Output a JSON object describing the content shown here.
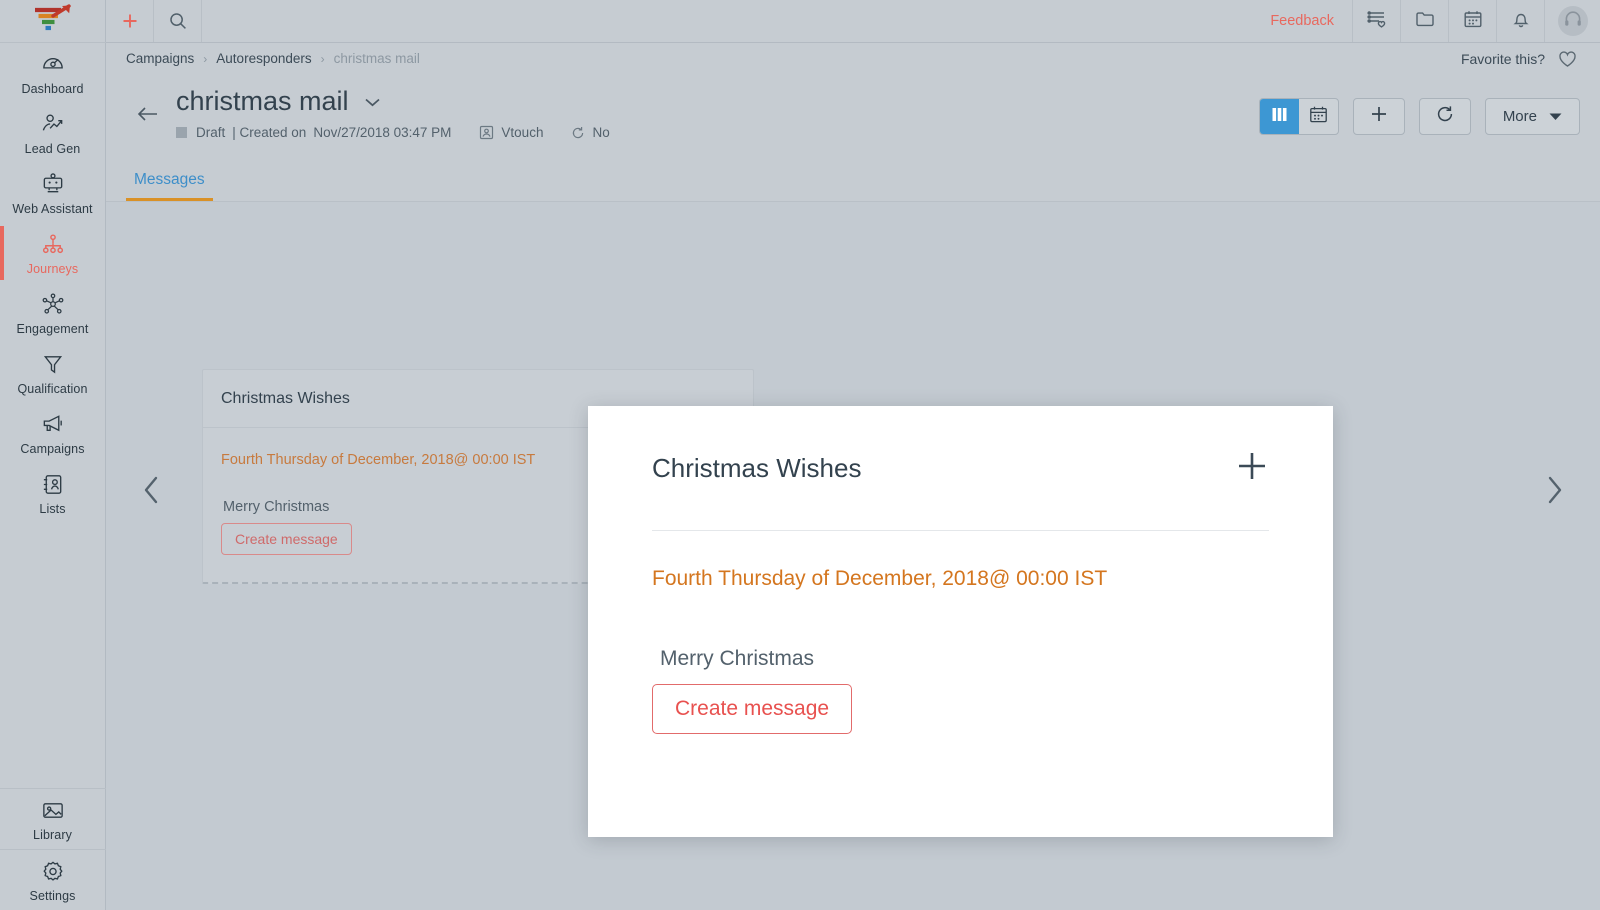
{
  "app": {
    "logo_name": "funnel-arrow-logo",
    "accent_red": "#e8685e",
    "accent_blue": "#3d8ec9",
    "accent_orange": "#d4761f"
  },
  "topbar": {
    "add_icon": "plus-icon",
    "search_icon": "search-icon",
    "feedback_label": "Feedback",
    "icons": [
      {
        "name": "list-favorites-icon"
      },
      {
        "name": "folder-icon"
      },
      {
        "name": "calendar-icon"
      },
      {
        "name": "bell-icon"
      }
    ],
    "avatar_icon": "headset-avatar-icon"
  },
  "breadcrumb": {
    "items": [
      {
        "label": "Campaigns",
        "current": false
      },
      {
        "label": "Autoresponders",
        "current": false
      },
      {
        "label": "christmas mail",
        "current": true
      }
    ],
    "separator": "›",
    "favorite_label": "Favorite this?",
    "favorite_icon": "heart-icon"
  },
  "header": {
    "back_icon": "arrow-left-icon",
    "title": "christmas mail",
    "title_caret_icon": "chevron-down-icon",
    "status": "Draft",
    "created_label": "| Created on",
    "created_on": "Nov/27/2018 03:47 PM",
    "owner_icon": "user-card-icon",
    "owner": "Vtouch",
    "repeat_icon": "refresh-small-icon",
    "repeat": "No",
    "actions": {
      "view_columns_icon": "columns-view-icon",
      "view_calendar_icon": "calendar-view-icon",
      "add_icon": "plus-icon",
      "refresh_icon": "refresh-icon",
      "more_label": "More",
      "more_caret_icon": "caret-down-icon"
    }
  },
  "tabs": [
    {
      "label": "Messages",
      "active": true
    }
  ],
  "canvas": {
    "prev_icon": "chevron-left-icon",
    "next_icon": "chevron-right-icon",
    "card": {
      "title": "Christmas Wishes",
      "schedule": "Fourth Thursday of December, 2018@ 00:00 IST",
      "message": "Merry Christmas",
      "create_label": "Create message"
    }
  },
  "modal": {
    "title": "Christmas Wishes",
    "add_icon": "plus-icon",
    "schedule": "Fourth Thursday of December, 2018@ 00:00 IST",
    "message": "Merry Christmas",
    "create_label": "Create message"
  },
  "sidebar": {
    "items": [
      {
        "label": "Dashboard",
        "icon": "speedometer-icon",
        "active": false
      },
      {
        "label": "Lead Gen",
        "icon": "lead-growth-icon",
        "active": false
      },
      {
        "label": "Web Assistant",
        "icon": "web-assistant-icon",
        "active": false
      },
      {
        "label": "Journeys",
        "icon": "journeys-tree-icon",
        "active": true
      },
      {
        "label": "Engagement",
        "icon": "engagement-network-icon",
        "active": false
      },
      {
        "label": "Qualification",
        "icon": "funnel-icon",
        "active": false
      },
      {
        "label": "Campaigns",
        "icon": "megaphone-icon",
        "active": false
      },
      {
        "label": "Lists",
        "icon": "contact-list-icon",
        "active": false
      }
    ],
    "bottom_items": [
      {
        "label": "Library",
        "icon": "image-library-icon"
      },
      {
        "label": "Settings",
        "icon": "gear-icon"
      }
    ]
  }
}
